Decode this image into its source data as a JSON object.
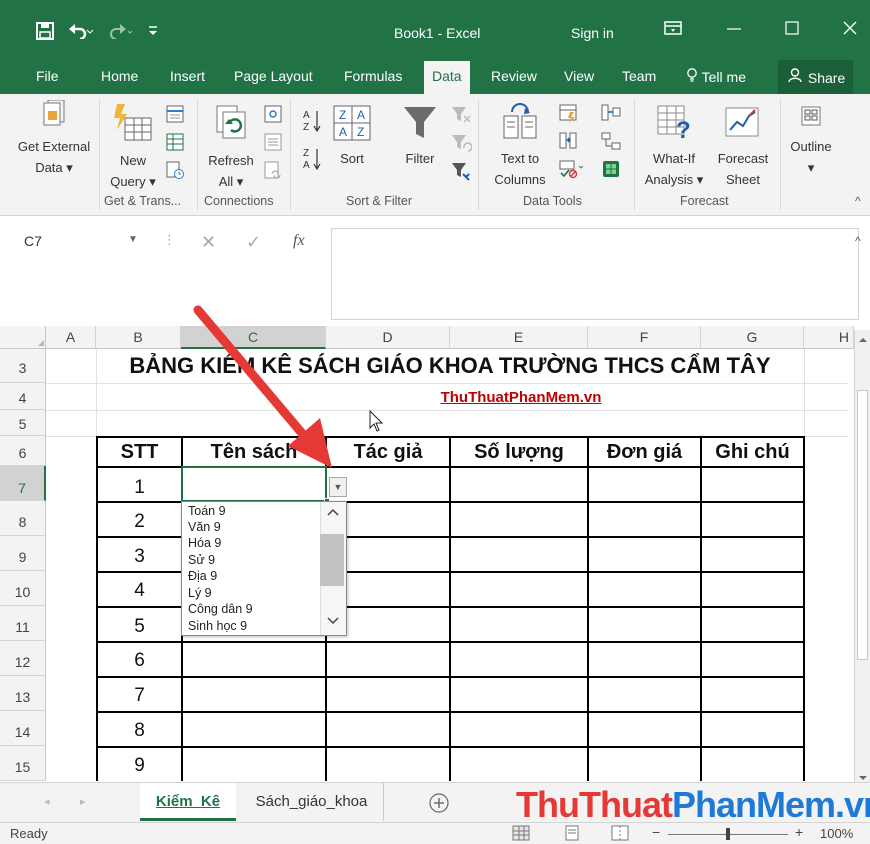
{
  "titlebar": {
    "title": "Book1  -  Excel",
    "signin": "Sign in",
    "icons": [
      "save-icon",
      "undo-icon",
      "redo-icon",
      "customize-icon",
      "ribbon-display-icon",
      "minimize-icon",
      "maximize-icon",
      "close-icon"
    ]
  },
  "tabs": [
    "File",
    "Home",
    "Insert",
    "Page Layout",
    "Formulas",
    "Data",
    "Review",
    "View",
    "Team",
    "Tell me",
    "Share"
  ],
  "active_tab": "Data",
  "ribbon": {
    "get_external_1": "Get External",
    "get_external_2": "Data ▾",
    "new_query_1": "New",
    "new_query_2": "Query ▾",
    "refresh_1": "Refresh",
    "refresh_2": "All ▾",
    "sort": "Sort",
    "filter": "Filter",
    "text_to_columns_1": "Text to",
    "text_to_columns_2": "Columns",
    "whatif_1": "What-If",
    "whatif_2": "Analysis ▾",
    "forecast_1": "Forecast",
    "forecast_2": "Sheet",
    "outline": "Outline",
    "groups": {
      "get_transform": "Get & Trans...",
      "connections": "Connections",
      "sort_filter": "Sort & Filter",
      "data_tools": "Data Tools",
      "forecast": "Forecast"
    }
  },
  "formula_bar": {
    "name_box": "C7",
    "fx": "fx",
    "value": ""
  },
  "columns": [
    "A",
    "B",
    "C",
    "D",
    "E",
    "F",
    "G",
    "H"
  ],
  "rows": [
    "3",
    "4",
    "5",
    "6",
    "7",
    "8",
    "9",
    "10",
    "11",
    "12",
    "13",
    "14",
    "15"
  ],
  "sheet": {
    "title": "BẢNG KIỂM KÊ SÁCH GIÁO KHOA TRƯỜNG THCS CẨM TÂY",
    "link": "ThuThuatPhanMem.vn",
    "headers": [
      "STT",
      "Tên sách",
      "Tác giả",
      "Số lượng",
      "Đơn giá",
      "Ghi chú"
    ],
    "stt": [
      "1",
      "2",
      "3",
      "4",
      "5",
      "6",
      "7",
      "8",
      "9"
    ]
  },
  "dropdown": {
    "options": [
      "Toán 9",
      "Văn 9",
      "Hóa 9",
      "Sử 9",
      "Địa 9",
      "Lý 9",
      "Công dân 9",
      "Sinh học 9"
    ]
  },
  "sheet_tabs": [
    "Kiểm_Kê",
    "Sách_giáo_khoa"
  ],
  "active_sheet": "Kiểm_Kê",
  "watermark": "ThuThuatPhanMem.vn",
  "status": {
    "ready": "Ready",
    "zoom": "100%"
  },
  "colors": {
    "excel_green": "#217346",
    "annotation_red": "#e53935",
    "link_red": "#c00000"
  }
}
